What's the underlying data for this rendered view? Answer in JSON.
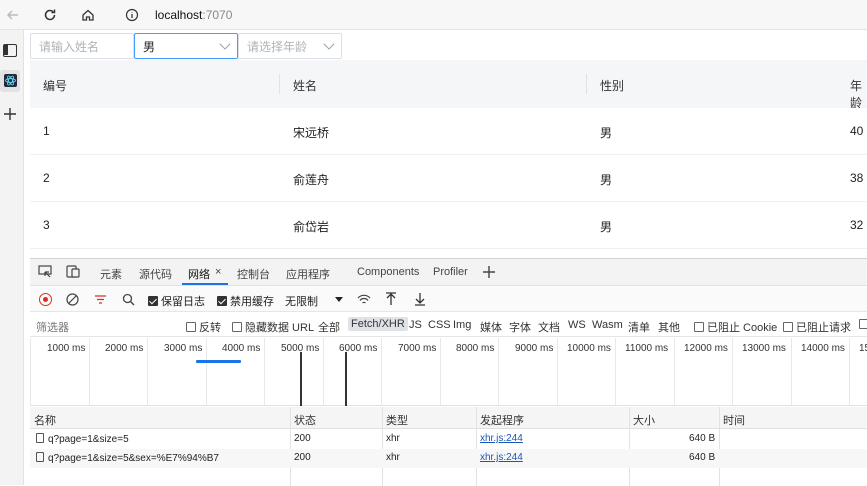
{
  "browser": {
    "url_host": "localhost",
    "url_port": ":7070"
  },
  "filters": {
    "name_placeholder": "请输入姓名",
    "sex_value": "男",
    "age_placeholder": "请选择年龄"
  },
  "table": {
    "columns": [
      "编号",
      "姓名",
      "性别",
      "年龄"
    ],
    "rows": [
      {
        "id": "1",
        "name": "宋远桥",
        "sex": "男",
        "age": "40"
      },
      {
        "id": "2",
        "name": "俞莲舟",
        "sex": "男",
        "age": "38"
      },
      {
        "id": "3",
        "name": "俞岱岩",
        "sex": "男",
        "age": "32"
      }
    ]
  },
  "devtools": {
    "tabs": [
      "元素",
      "源代码",
      "网络",
      "控制台",
      "应用程序",
      "Components",
      "Profiler"
    ],
    "active_tab": "网络",
    "tab_close": "×",
    "toolbar": {
      "preserve_log": "保留日志",
      "disable_cache": "禁用缓存",
      "throttle": "无限制"
    },
    "filter": {
      "label": "筛选器",
      "invert": "反转",
      "hide_data_url": "隐藏数据 URL",
      "types": [
        "全部",
        "Fetch/XHR",
        "JS",
        "CSS",
        "Img",
        "媒体",
        "字体",
        "文档",
        "WS",
        "Wasm",
        "清单",
        "其他"
      ],
      "selected_type": "Fetch/XHR",
      "blocked_cookie": "已阻止 Cookie",
      "blocked_request": "已阻止请求"
    },
    "timeline_labels": [
      "1000 ms",
      "2000 ms",
      "3000 ms",
      "4000 ms",
      "5000 ms",
      "6000 ms",
      "7000 ms",
      "8000 ms",
      "9000 ms",
      "10000 ms",
      "11000 ms",
      "12000 ms",
      "13000 ms",
      "14000 ms",
      "15"
    ],
    "grid": {
      "headers": [
        "名称",
        "状态",
        "类型",
        "发起程序",
        "大小",
        "时间"
      ],
      "rows": [
        {
          "name": "q?page=1&size=5",
          "status": "200",
          "type": "xhr",
          "initiator": "xhr.js:244",
          "size": "640 B"
        },
        {
          "name": "q?page=1&size=5&sex=%E7%94%B7",
          "status": "200",
          "type": "xhr",
          "initiator": "xhr.js:244",
          "size": "640 B"
        }
      ]
    }
  },
  "colors": {
    "accent": "#1a73e8",
    "record": "#d93025"
  }
}
